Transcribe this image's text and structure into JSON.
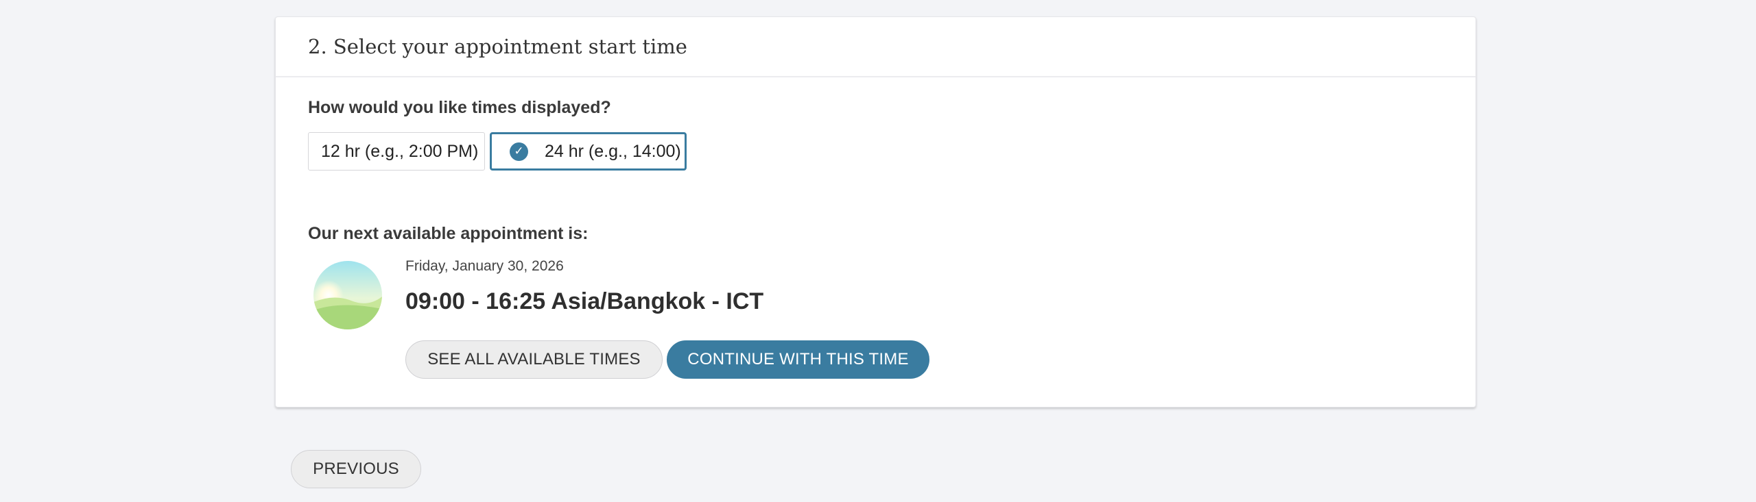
{
  "step": {
    "title": "2. Select your appointment start time"
  },
  "time_format": {
    "question": "How would you like times displayed?",
    "options": [
      {
        "label": "12 hr (e.g., 2:00 PM)",
        "selected": false
      },
      {
        "label": "24 hr (e.g., 14:00)",
        "selected": true
      }
    ],
    "check_icon": "check-circle-icon",
    "accent_color": "#3a7ca0"
  },
  "next_available": {
    "label": "Our next available appointment is:",
    "image_icon": "sunrise-icon",
    "date": "Friday, January 30, 2026",
    "time": "09:00 - 16:25 Asia/Bangkok - ICT",
    "see_all_label": "SEE ALL AVAILABLE TIMES",
    "continue_label": "CONTINUE WITH THIS TIME"
  },
  "navigation": {
    "previous_label": "PREVIOUS"
  }
}
